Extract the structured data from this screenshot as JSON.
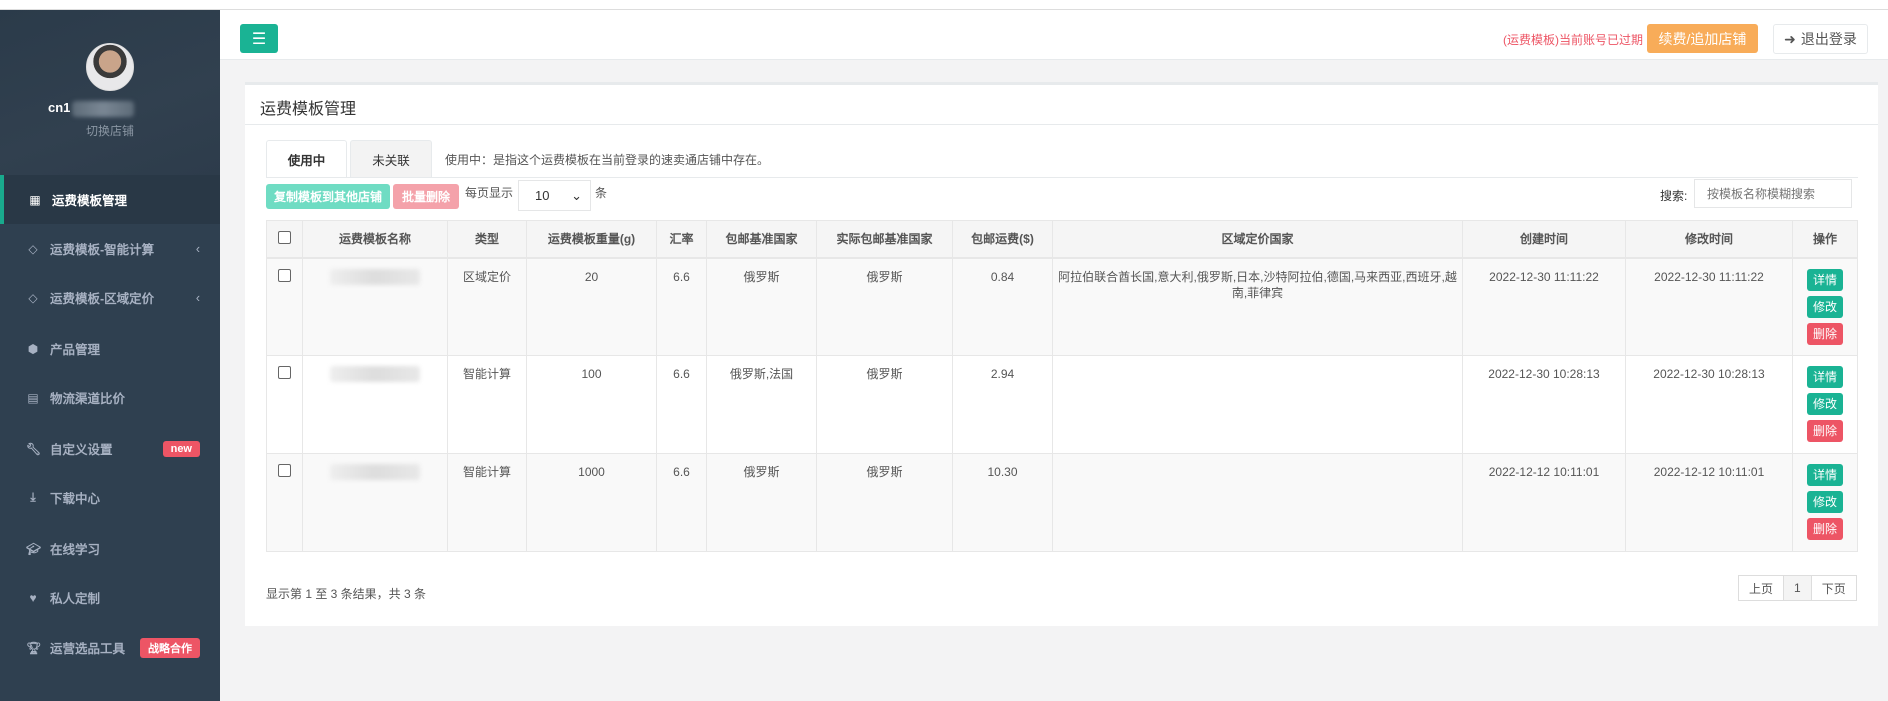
{
  "user": {
    "switch_store": "切换店铺",
    "name_prefix": "cn1"
  },
  "sidebar": {
    "items": [
      {
        "label": "运费模板管理",
        "icon": "table-icon",
        "active": true
      },
      {
        "label": "运费模板-智能计算",
        "icon": "diamond-icon",
        "chevron": "‹"
      },
      {
        "label": "运费模板-区域定价",
        "icon": "diamond-icon",
        "chevron": "‹"
      },
      {
        "label": "产品管理",
        "icon": "cube-icon"
      },
      {
        "label": "物流渠道比价",
        "icon": "calculator-icon"
      },
      {
        "label": "自定义设置",
        "icon": "wrench-icon",
        "badge": "new"
      },
      {
        "label": "下载中心",
        "icon": "download-icon"
      },
      {
        "label": "在线学习",
        "icon": "graduation-cap-icon"
      },
      {
        "label": "私人定制",
        "icon": "heart-icon"
      },
      {
        "label": "运营选品工具",
        "icon": "trophy-icon",
        "badge": "战略合作"
      }
    ]
  },
  "topbar": {
    "expired_notice": "(运费模板)当前账号已过期",
    "renew_label": "续费/追加店铺",
    "logout_label": "退出登录"
  },
  "panel": {
    "title": "运费模板管理",
    "tabs": [
      "使用中",
      "未关联"
    ],
    "tab_note": "使用中：是指这个运费模板在当前登录的速卖通店铺中存在。",
    "copy_label": "复制模板到其他店铺",
    "batch_delete_label": "批量删除",
    "per_page_label": "每页显示",
    "per_page_value": "10",
    "per_page_unit": "条",
    "search_label": "搜索:",
    "search_placeholder": "按模板名称模糊搜索",
    "columns": [
      "运费模板名称",
      "类型",
      "运费模板重量(g)",
      "汇率",
      "包邮基准国家",
      "实际包邮基准国家",
      "包邮运费($)",
      "区域定价国家",
      "创建时间",
      "修改时间",
      "操作"
    ],
    "rows": [
      {
        "type": "区域定价",
        "weight": "20",
        "rate": "6.6",
        "base": "俄罗斯",
        "actual": "俄罗斯",
        "fee": "0.84",
        "region": "阿拉伯联合酋长国,意大利,俄罗斯,日本,沙特阿拉伯,德国,马来西亚,西班牙,越南,菲律宾",
        "created": "2022-12-30 11:11:22",
        "modified": "2022-12-30 11:11:22"
      },
      {
        "type": "智能计算",
        "weight": "100",
        "rate": "6.6",
        "base": "俄罗斯,法国",
        "actual": "俄罗斯",
        "fee": "2.94",
        "region": "",
        "created": "2022-12-30 10:28:13",
        "modified": "2022-12-30 10:28:13"
      },
      {
        "type": "智能计算",
        "weight": "1000",
        "rate": "6.6",
        "base": "俄罗斯",
        "actual": "俄罗斯",
        "fee": "10.30",
        "region": "",
        "created": "2022-12-12 10:11:01",
        "modified": "2022-12-12 10:11:01"
      }
    ],
    "actions": {
      "detail": "详情",
      "edit": "修改",
      "delete": "删除"
    },
    "footer": "显示第 1 至 3 条结果，共 3 条",
    "pager": {
      "prev": "上页",
      "current": "1",
      "next": "下页"
    }
  },
  "colors": {
    "primary": "#1ab394",
    "danger": "#ed5565",
    "warning": "#f8ac59",
    "sidebar": "#2f4050"
  }
}
